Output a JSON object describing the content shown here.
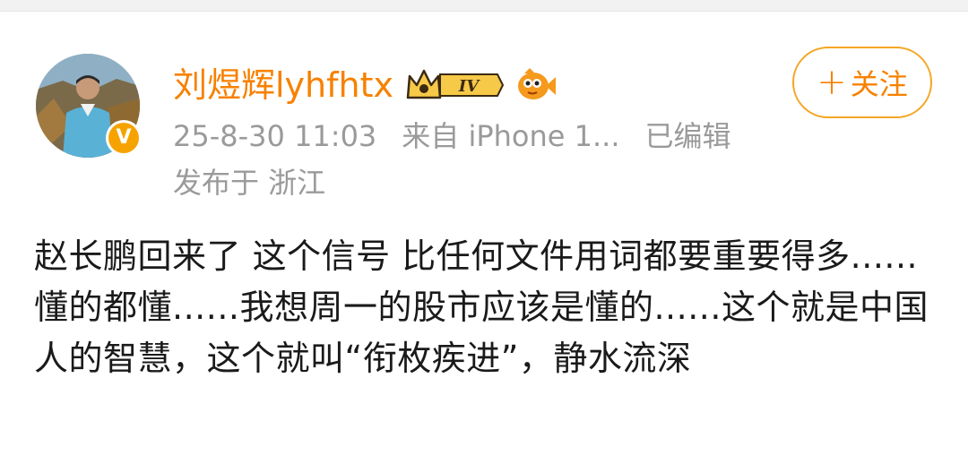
{
  "user": {
    "name": "刘煜辉lyhfhtx",
    "level": "IV",
    "verified_mark": "V"
  },
  "follow": {
    "plus": "+",
    "label": "关注"
  },
  "meta": {
    "time": "25-8-30 11:03",
    "source": "来自 iPhone 1...",
    "edited": "已编辑",
    "location": "发布于 浙江"
  },
  "post": {
    "text": "赵长鹏回来了 这个信号 比任何文件用词都要重要得多...... 懂的都懂......我想周一的股市应该是懂的......这个就是中国人的智慧，这个就叫“衔枚疾进”，静水流深"
  },
  "colors": {
    "username": "#f78100",
    "follow_border": "#f5a623",
    "meta_gray": "#9a9a9a",
    "badge_gold": "#f6a300"
  },
  "icons": [
    "avatar",
    "verified-badge-icon",
    "crown-level-badge-icon",
    "fish-icon",
    "plus-icon"
  ]
}
